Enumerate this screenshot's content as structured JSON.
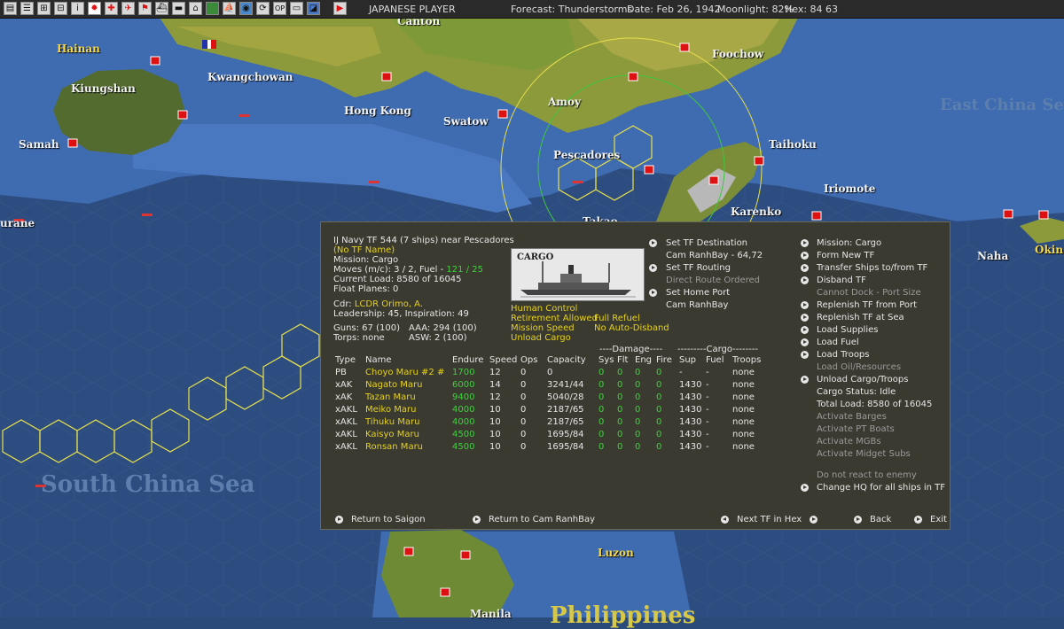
{
  "topbar": {
    "player": "JAPANESE PLAYER",
    "forecast": "Forecast: Thunderstorms",
    "date": "Date: Feb 26, 1942",
    "moonlight": "Moonlight: 82%",
    "hex": "Hex: 84 63",
    "buttons": [
      "Turn Info",
      "Reports",
      "Intel",
      "Ships",
      "Info",
      "Japan",
      "Ground",
      "Air",
      "Flag",
      "Naval",
      "Sub",
      "Base",
      "TF",
      "Carrier",
      "Cycle",
      "OP",
      "Menu",
      "Map",
      "Mirror",
      "End Turn"
    ]
  },
  "map": {
    "places": [
      "Canton",
      "Hainan",
      "Kwangchowan",
      "Kiungshan",
      "Samah",
      "Hong Kong",
      "Swatow",
      "Amoy",
      "Foochow",
      "Pescadores",
      "Taihoku",
      "Iriomote",
      "Takao",
      "Karenko",
      "Naha",
      "Okin",
      "urane",
      "Luzon",
      "Manila",
      "Philippines"
    ],
    "seas": [
      "South China Sea",
      "East China Sea"
    ]
  },
  "panel": {
    "tf_title": "IJ Navy TF 544 (7 ships) near Pescadores",
    "tf_name": "(No TF Name)",
    "mission": "Mission: Cargo",
    "moves_prefix": "Moves (m/c): 3 / 2, Fuel - ",
    "moves_fuel": "121 / 25",
    "current_load": "Current Load: 8580 of 16045",
    "float_planes": "Float Planes: 0",
    "cdr_prefix": "Cdr:",
    "cdr_name": "LCDR Orimo, A.",
    "leadership": "Leadership: 45, Inspiration: 49",
    "guns": "Guns: 67 (100)",
    "aaa": "AAA: 294 (100)",
    "torps": "Torps: none",
    "asw": "ASW: 2 (100)",
    "cargo_badge": "CARGO",
    "options_left": [
      "Human Control",
      "Retirement Allowed",
      "Mission Speed",
      "Unload Cargo"
    ],
    "options_right": [
      "Full Refuel",
      "No Auto-Disband"
    ],
    "mid_commands": [
      {
        "label": "Set TF Destination",
        "kind": "cmd"
      },
      {
        "label": "Cam RanhBay - 64,72",
        "kind": "info"
      },
      {
        "label": "Set TF Routing",
        "kind": "cmd"
      },
      {
        "label": "Direct Route Ordered",
        "kind": "dim"
      },
      {
        "label": "Set Home Port",
        "kind": "cmd"
      },
      {
        "label": "Cam RanhBay",
        "kind": "info"
      }
    ],
    "right_commands": [
      {
        "label": "Mission: Cargo",
        "kind": "cmd"
      },
      {
        "label": "Form New TF",
        "kind": "cmd"
      },
      {
        "label": "Transfer Ships to/from TF",
        "kind": "cmd"
      },
      {
        "label": "Disband TF",
        "kind": "cmd"
      },
      {
        "label": "Cannot Dock - Port Size",
        "kind": "dim"
      },
      {
        "label": "Replenish TF from Port",
        "kind": "cmd"
      },
      {
        "label": "Replenish TF at Sea",
        "kind": "cmd"
      },
      {
        "label": "Load Supplies",
        "kind": "cmd"
      },
      {
        "label": "Load Fuel",
        "kind": "cmd"
      },
      {
        "label": "Load Troops",
        "kind": "cmd"
      },
      {
        "label": "Load Oil/Resources",
        "kind": "dim"
      },
      {
        "label": "Unload Cargo/Troops",
        "kind": "cmd"
      },
      {
        "label": "Cargo Status: Idle",
        "kind": "info"
      },
      {
        "label": "Total Load: 8580 of 16045",
        "kind": "info"
      },
      {
        "label": "Activate Barges",
        "kind": "dim"
      },
      {
        "label": "Activate PT Boats",
        "kind": "dim"
      },
      {
        "label": "Activate MGBs",
        "kind": "dim"
      },
      {
        "label": "Activate Midget Subs",
        "kind": "dim"
      }
    ],
    "react": "Do not react to enemy",
    "change_hq": "Change HQ for all ships in TF",
    "group_damage": "----Damage----",
    "group_cargo": "---------Cargo--------",
    "columns": [
      "Type",
      "Name",
      "Endure",
      "Speed",
      "Ops",
      "Capacity",
      "Sys",
      "Flt",
      "Eng",
      "Fire",
      "Sup",
      "Fuel",
      "Troops"
    ],
    "ships": [
      {
        "type": "PB",
        "name": "Choyo Maru #2 #",
        "endure": "1700",
        "speed": "12",
        "ops": "0",
        "capacity": "0",
        "sys": "0",
        "flt": "0",
        "eng": "0",
        "fire": "0",
        "sup": "-",
        "fuel": "-",
        "troops": "none"
      },
      {
        "type": "xAK",
        "name": "Nagato Maru",
        "endure": "6000",
        "speed": "14",
        "ops": "0",
        "capacity": "3241/44",
        "sys": "0",
        "flt": "0",
        "eng": "0",
        "fire": "0",
        "sup": "1430",
        "fuel": "-",
        "troops": "none"
      },
      {
        "type": "xAK",
        "name": "Tazan Maru",
        "endure": "9400",
        "speed": "12",
        "ops": "0",
        "capacity": "5040/28",
        "sys": "0",
        "flt": "0",
        "eng": "0",
        "fire": "0",
        "sup": "1430",
        "fuel": "-",
        "troops": "none"
      },
      {
        "type": "xAKL",
        "name": "Meiko Maru",
        "endure": "4000",
        "speed": "10",
        "ops": "0",
        "capacity": "2187/65",
        "sys": "0",
        "flt": "0",
        "eng": "0",
        "fire": "0",
        "sup": "1430",
        "fuel": "-",
        "troops": "none"
      },
      {
        "type": "xAKL",
        "name": "Tihuku Maru",
        "endure": "4000",
        "speed": "10",
        "ops": "0",
        "capacity": "2187/65",
        "sys": "0",
        "flt": "0",
        "eng": "0",
        "fire": "0",
        "sup": "1430",
        "fuel": "-",
        "troops": "none"
      },
      {
        "type": "xAKL",
        "name": "Kaisyo Maru",
        "endure": "4500",
        "speed": "10",
        "ops": "0",
        "capacity": "1695/84",
        "sys": "0",
        "flt": "0",
        "eng": "0",
        "fire": "0",
        "sup": "1430",
        "fuel": "-",
        "troops": "none"
      },
      {
        "type": "xAKL",
        "name": "Ronsan Maru",
        "endure": "4500",
        "speed": "10",
        "ops": "0",
        "capacity": "1695/84",
        "sys": "0",
        "flt": "0",
        "eng": "0",
        "fire": "0",
        "sup": "1430",
        "fuel": "-",
        "troops": "none"
      }
    ],
    "footer": {
      "return_saigon": "Return to Saigon",
      "return_cam": "Return to Cam RanhBay",
      "next_tf": "Next TF in Hex",
      "back": "Back",
      "exit": "Exit"
    }
  }
}
